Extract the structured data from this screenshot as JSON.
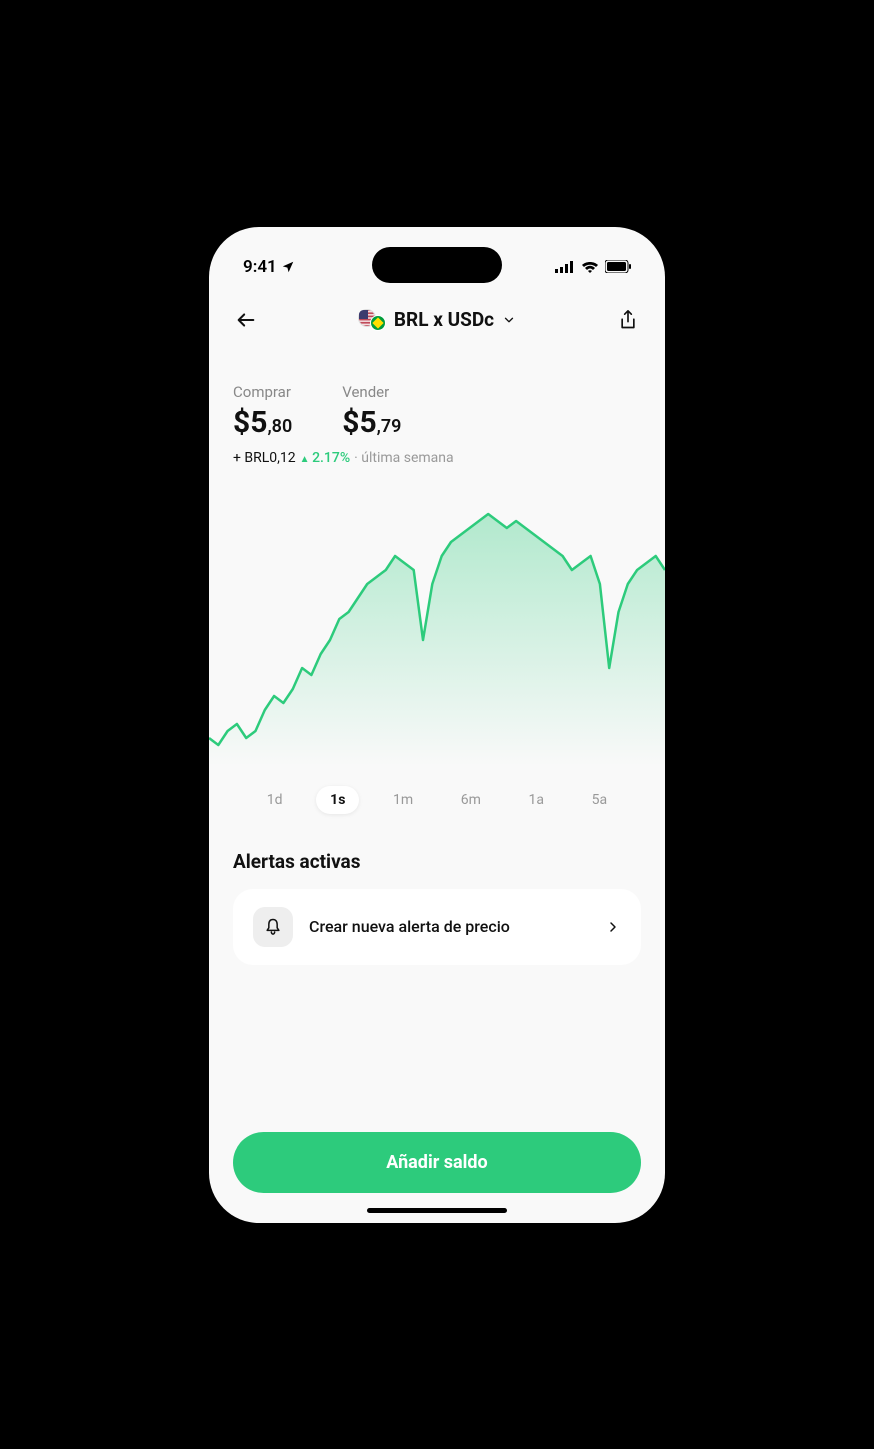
{
  "status": {
    "time": "9:41"
  },
  "header": {
    "pair": "BRL x USDc"
  },
  "prices": {
    "buy_label": "Comprar",
    "buy_whole": "$5",
    "buy_cents": ",80",
    "sell_label": "Vender",
    "sell_whole": "$5",
    "sell_cents": ",79"
  },
  "delta": {
    "abs": "+ BRL0,12",
    "pct": "2.17%",
    "period": "· última semana"
  },
  "ranges": {
    "items": [
      "1d",
      "1s",
      "1m",
      "6m",
      "1a",
      "5a"
    ],
    "active_index": 1
  },
  "alerts": {
    "title": "Alertas activas",
    "create_label": "Crear nueva alerta de precio"
  },
  "footer": {
    "add_balance": "Añadir saldo"
  },
  "colors": {
    "accent": "#2dcb7c"
  },
  "chart_data": {
    "type": "area",
    "title": "",
    "xlabel": "",
    "ylabel": "",
    "ylim": [
      5.65,
      5.85
    ],
    "x": [
      0,
      1,
      2,
      3,
      4,
      5,
      6,
      7,
      8,
      9,
      10,
      11,
      12,
      13,
      14,
      15,
      16,
      17,
      18,
      19,
      20,
      21,
      22,
      23,
      24,
      25,
      26,
      27,
      28,
      29,
      30,
      31,
      32,
      33,
      34,
      35,
      36,
      37,
      38,
      39,
      40,
      41,
      42,
      43,
      44,
      45,
      46,
      47,
      48,
      49
    ],
    "series": [
      {
        "name": "BRL/USDc",
        "values": [
          5.67,
          5.665,
          5.675,
          5.68,
          5.67,
          5.675,
          5.69,
          5.7,
          5.695,
          5.705,
          5.72,
          5.715,
          5.73,
          5.74,
          5.755,
          5.76,
          5.77,
          5.78,
          5.785,
          5.79,
          5.8,
          5.795,
          5.79,
          5.74,
          5.78,
          5.8,
          5.81,
          5.815,
          5.82,
          5.825,
          5.83,
          5.825,
          5.82,
          5.825,
          5.82,
          5.815,
          5.81,
          5.805,
          5.8,
          5.79,
          5.795,
          5.8,
          5.78,
          5.72,
          5.76,
          5.78,
          5.79,
          5.795,
          5.8,
          5.79
        ]
      }
    ]
  }
}
